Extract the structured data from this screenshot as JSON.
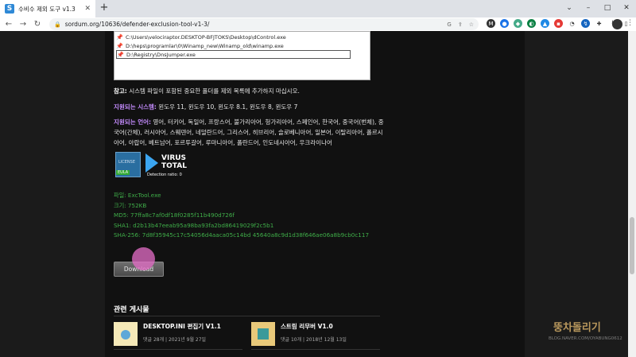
{
  "browser": {
    "tab_title": "수비수 제외 도구 v1.3",
    "tab_favicon": "S",
    "url": "sordum.org/10636/defender-exclusion-tool-v1-3/"
  },
  "listbox": {
    "rows": [
      "C:\\Users\\velociraptor.DESKTOP-BFJTOKS\\Desktop\\dControl.exe",
      "D:\\heps\\programlar\\0\\Winamp_new\\Winamp_old\\winamp.exe",
      "D:\\Registry\\DnsJumper.exe"
    ]
  },
  "note": {
    "label": "참고:",
    "text": " 시스템 파일이 포함된 중요한 폴더를 제외 목록에 추가하지 마십시오."
  },
  "os": {
    "label": "지원되는 시스템:",
    "text": " 윈도우 11, 윈도우 10, 윈도우 8.1, 윈도우 8, 윈도우 7"
  },
  "languages": {
    "label": "지원되는 언어:",
    "text": " 영어, 터키어, 독일어, 프랑스어, 불가리아어, 헝가리아어, 스페인어, 한국어, 중국어(번체), 중국어(간체), 러시아어, 스웨덴어, 네덜란드어, 그리스어, 히브리어, 슬로베니아어, 일본어, 이탈리아어, 폴르시아어, 아랍어, 베트남어, 포르투갈어, 루마니아어, 폴란드어, 인도네시아어, 우크라이나어"
  },
  "badges": {
    "license_top": "LICENSE",
    "license_bottom": "EULA",
    "vt_line1": "VIRUS",
    "vt_line2": "TOTAL",
    "vt_ratio": "Detection ratio:  0"
  },
  "fileinfo": {
    "file": "파일: ExcTool.exe",
    "size": "크기: 752KB",
    "md5": "MD5: 77ffa8c7af0df18f0285f11b490d726f",
    "sha1": "SHA1: d2b13b47eeab95a98ba93fa2bd86419029f2c5b1",
    "sha256": "SHA-256: 7d8f35945c17c54056d4aaca05c14bd 45640a8c9d1d38f646ae06a8b9cb0c117"
  },
  "download": {
    "label": "Download"
  },
  "related": {
    "title": "관련 게시물",
    "posts": [
      {
        "title": "DESKTOP.INI 편집기 V1.1",
        "meta": "댓글 28개 | 2021년 9월 27일"
      },
      {
        "title": "스트림 리무버 V1.0",
        "meta": "댓글 10개 | 2018년 12월 13일"
      }
    ]
  },
  "watermark": {
    "line1": "뚱차돌리기",
    "line2": "BLOG.NAVER.COM/OYABUNG0612"
  }
}
